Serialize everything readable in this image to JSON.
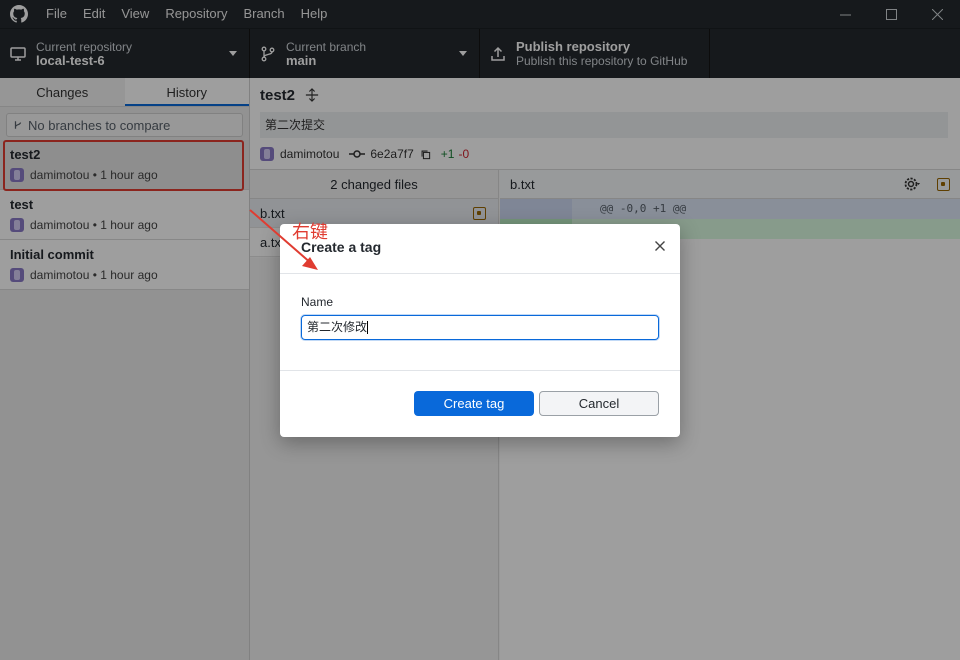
{
  "menu": [
    "File",
    "Edit",
    "View",
    "Repository",
    "Branch",
    "Help"
  ],
  "toolbar": {
    "repo": {
      "sub": "Current repository",
      "main": "local-test-6"
    },
    "branch": {
      "sub": "Current branch",
      "main": "main"
    },
    "publish": {
      "main": "Publish repository",
      "sub": "Publish this repository to GitHub"
    }
  },
  "sidebar": {
    "tabs": [
      "Changes",
      "History"
    ],
    "branch_compare_placeholder": "No branches to compare",
    "commits": [
      {
        "title": "test2",
        "author": "damimotou",
        "time": "1 hour ago"
      },
      {
        "title": "test",
        "author": "damimotou",
        "time": "1 hour ago"
      },
      {
        "title": "Initial commit",
        "author": "damimotou",
        "time": "1 hour ago"
      }
    ]
  },
  "commit_detail": {
    "title": "test2",
    "description": "第二次提交",
    "author": "damimotou",
    "sha": "6e2a7f7",
    "additions": "+1",
    "deletions": "-0",
    "changed_files_label": "2 changed files",
    "files": [
      "b.txt",
      "a.txt"
    ],
    "diff_file": "b.txt",
    "hunk_header": "@@ -0,0 +1 @@"
  },
  "dialog": {
    "title": "Create a tag",
    "name_label": "Name",
    "name_value": "第二次修改",
    "create_label": "Create tag",
    "cancel_label": "Cancel"
  },
  "annotation": {
    "text": "右键",
    "color": "#e03c31"
  },
  "colors": {
    "accent": "#0969da",
    "chrome": "#24292e"
  }
}
